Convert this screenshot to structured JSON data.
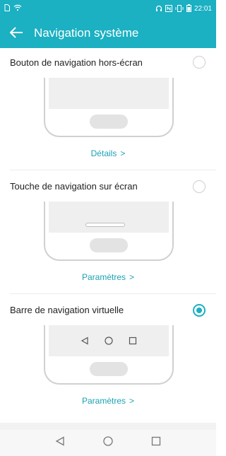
{
  "status_bar": {
    "time": "22:01",
    "left_icons": [
      "sim-icon",
      "wifi-icon"
    ],
    "right_icons": [
      "headphones-icon",
      "nfc-icon",
      "vibrate-icon",
      "battery-icon"
    ]
  },
  "app_bar": {
    "title": "Navigation système",
    "back_icon": "arrow-left-icon"
  },
  "options": [
    {
      "label": "Bouton de navigation hors-écran",
      "link": "Détails",
      "selected": false
    },
    {
      "label": "Touche de navigation sur écran",
      "link": "Paramètres",
      "selected": false
    },
    {
      "label": "Barre de navigation virtuelle",
      "link": "Paramètres",
      "selected": true
    }
  ],
  "colors": {
    "accent": "#1bb0c2",
    "link": "#1aa3b4",
    "text": "#222222"
  },
  "system_nav": {
    "icons": [
      "back-triangle-icon",
      "home-circle-icon",
      "recents-square-icon"
    ]
  }
}
